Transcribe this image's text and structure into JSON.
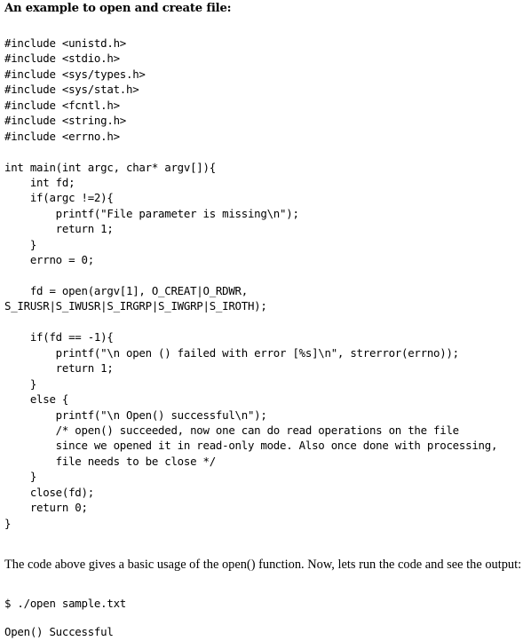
{
  "heading": "An example to open and create file:",
  "code_lines": [
    "",
    "#include <unistd.h>",
    "#include <stdio.h>",
    "#include <sys/types.h>",
    "#include <sys/stat.h>",
    "#include <fcntl.h>",
    "#include <string.h>",
    "#include <errno.h>",
    "",
    "int main(int argc, char* argv[]){",
    "    int fd;",
    "    if(argc !=2){",
    "        printf(\"File parameter is missing\\n\");",
    "        return 1;",
    "    }",
    "    errno = 0;",
    "",
    "    fd = open(argv[1], O_CREAT|O_RDWR,",
    "S_IRUSR|S_IWUSR|S_IRGRP|S_IWGRP|S_IROTH);",
    "",
    "    if(fd == -1){",
    "        printf(\"\\n open () failed with error [%s]\\n\", strerror(errno));",
    "        return 1;",
    "    }",
    "    else {",
    "        printf(\"\\n Open() successful\\n\");",
    "        /* open() succeeded, now one can do read operations on the file",
    "        since we opened it in read-only mode. Also once done with processing,",
    "        file needs to be close */",
    "    }",
    "    close(fd);",
    "    return 0;",
    "}"
  ],
  "paragraph": "The code above gives a basic usage of the open() function. Now, lets run the code and see the output:",
  "command": "$ ./open sample.txt",
  "output": "Open() Successful"
}
